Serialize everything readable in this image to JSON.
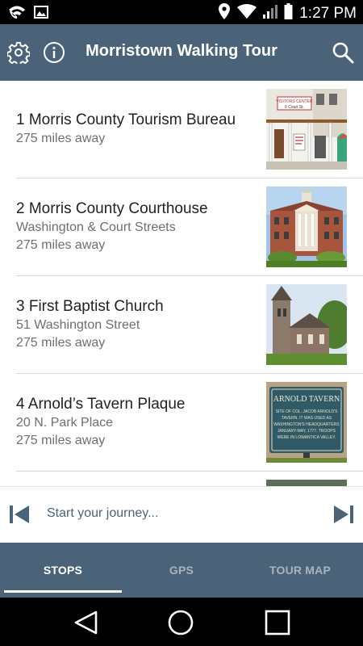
{
  "status_bar": {
    "time": "1:27 PM",
    "icons": [
      "wifi-call-icon",
      "image-notification-icon",
      "location-pin-icon",
      "wifi-signal-icon",
      "cell-signal-icon",
      "battery-icon"
    ]
  },
  "app_bar": {
    "title": "Morristown Walking Tour",
    "left_icons": [
      "gear-icon",
      "info-icon"
    ],
    "right_icon": "search-icon"
  },
  "stops": [
    {
      "title": "1 Morris County Tourism Bureau",
      "address": "",
      "distance": "275 miles away",
      "thumb_sign": [
        "VISITORS CENTER",
        "6 Court St."
      ]
    },
    {
      "title": "2 Morris County Courthouse",
      "address": "Washington & Court Streets",
      "distance": "275 miles away"
    },
    {
      "title": "3 First Baptist Church",
      "address": "51 Washington Street",
      "distance": "275 miles away"
    },
    {
      "title": "4 Arnold’s Tavern Plaque",
      "address": "20 N. Park Place",
      "distance": "275 miles away",
      "thumb_sign": [
        "ARNOLD TAVERN",
        "SITE OF COL. JACOB ARNOLD'S",
        "TAVERN. IT WAS USED AS",
        "WASHINGTON'S HEADQUARTERS",
        "JANUARY-MAY, 1777. TROOPS",
        "WERE IN LOWANTICA VALLEY."
      ]
    }
  ],
  "journey": {
    "label": "Start your journey...",
    "prev_icon": "skip-previous-icon",
    "next_icon": "skip-next-icon"
  },
  "tabs": [
    {
      "label": "STOPS",
      "active": true
    },
    {
      "label": "GPS",
      "active": false
    },
    {
      "label": "TOUR MAP",
      "active": false
    }
  ],
  "colors": {
    "primary": "#4a6379",
    "tab_inactive": "#a8b4bf",
    "divider": "#d6d6d6"
  },
  "system_nav": [
    "back-icon",
    "home-icon",
    "recents-icon"
  ]
}
